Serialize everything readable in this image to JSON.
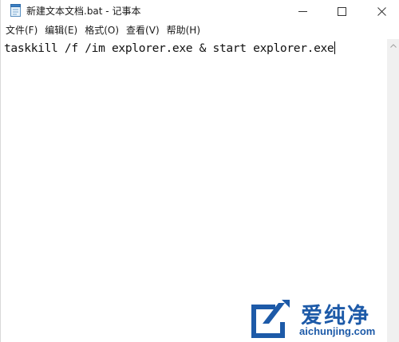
{
  "window": {
    "title": "新建文本文档.bat - 记事本"
  },
  "menu": {
    "items": [
      {
        "label": "文件(F)"
      },
      {
        "label": "编辑(E)"
      },
      {
        "label": "格式(O)"
      },
      {
        "label": "查看(V)"
      },
      {
        "label": "帮助(H)"
      }
    ]
  },
  "editor": {
    "content": "taskkill /f /im explorer.exe & start explorer.exe"
  },
  "watermark": {
    "brand_cn": "爱纯净",
    "url": "aichunjing.com"
  },
  "icons": {
    "app": "notepad-icon",
    "minimize": "minimize-icon",
    "maximize": "maximize-icon",
    "close": "close-icon",
    "scroll_up": "chevron-up-icon"
  },
  "colors": {
    "watermark_blue": "#1d5aa8",
    "scrollbar": "#f0f0f0"
  }
}
